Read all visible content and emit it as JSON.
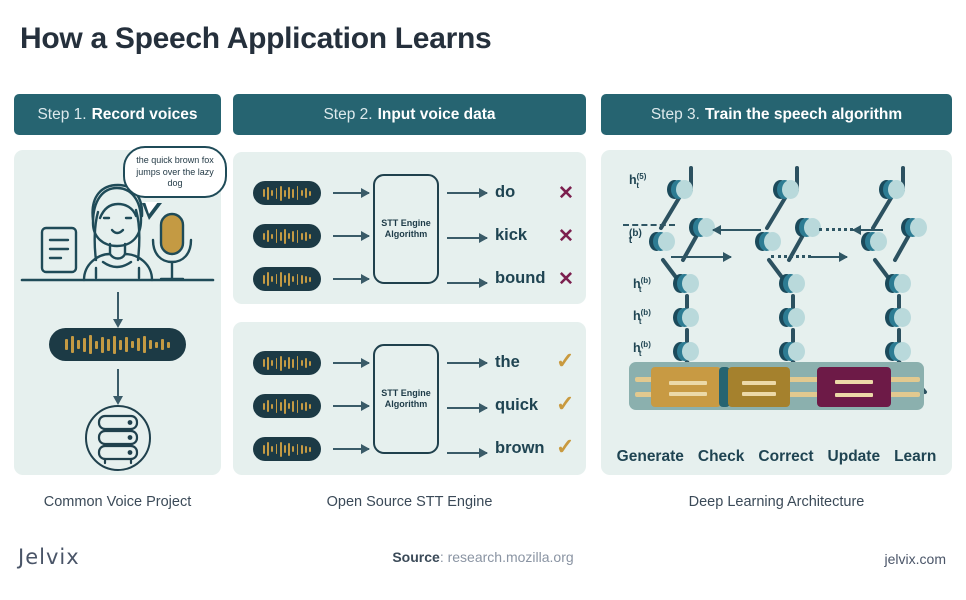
{
  "header": {
    "title": "How a Speech Application Learns"
  },
  "steps": [
    {
      "prefix": "Step 1.",
      "label": "Record voices"
    },
    {
      "prefix": "Step 2.",
      "label": "Input voice data"
    },
    {
      "prefix": "Step 3.",
      "label": "Train the speech algorithm"
    }
  ],
  "captions": [
    "Common Voice Project",
    "Open Source STT Engine",
    "Deep Learning Architecture"
  ],
  "panel1": {
    "speech_bubble": "the quick brown fox jumps over the lazy dog",
    "icons": {
      "person": "person-speaking-icon",
      "microphone": "microphone-icon",
      "document": "document-icon",
      "waveform": "waveform-pill",
      "database": "database-icon"
    }
  },
  "panel2": {
    "engine_label_line1": "STT Engine",
    "engine_label_line2": "Algorithm",
    "incorrect_group": {
      "results": [
        {
          "word": "do",
          "mark": "x",
          "mark_glyph": "✕"
        },
        {
          "word": "kick",
          "mark": "x",
          "mark_glyph": "✕"
        },
        {
          "word": "bound",
          "mark": "x",
          "mark_glyph": "✕"
        }
      ]
    },
    "correct_group": {
      "results": [
        {
          "word": "the",
          "mark": "check",
          "mark_glyph": "✓"
        },
        {
          "word": "quick",
          "mark": "check",
          "mark_glyph": "✓"
        },
        {
          "word": "brown",
          "mark": "check",
          "mark_glyph": "✓"
        }
      ]
    }
  },
  "panel3": {
    "node_labels": [
      {
        "base": "h",
        "sub": "t",
        "sup": "(5)"
      },
      {
        "base": "",
        "sub": "t",
        "sup": "(b)"
      },
      {
        "base": "h",
        "sub": "t",
        "sup": "(b)"
      },
      {
        "base": "h",
        "sub": "t",
        "sup": "(b)"
      },
      {
        "base": "h",
        "sub": "t",
        "sup": "(b)"
      }
    ],
    "process_words": [
      "Generate",
      "Check",
      "Correct",
      "Update",
      "Learn"
    ]
  },
  "footer": {
    "logo": "Jelvix",
    "source_label": "Source",
    "source_value": "research.mozilla.org",
    "website": "jelvix.com"
  },
  "colors": {
    "teal_header": "#266471",
    "panel_bg": "#e6f0ee",
    "dark_navy": "#1c3a45",
    "gold": "#c49a43",
    "maroon": "#7b1f4e",
    "title_text": "#25303c",
    "node_light": "#b9d9db",
    "node_mid": "#2d7c93",
    "node_dark": "#1b4a5b",
    "slab": "#8bb0ae"
  }
}
